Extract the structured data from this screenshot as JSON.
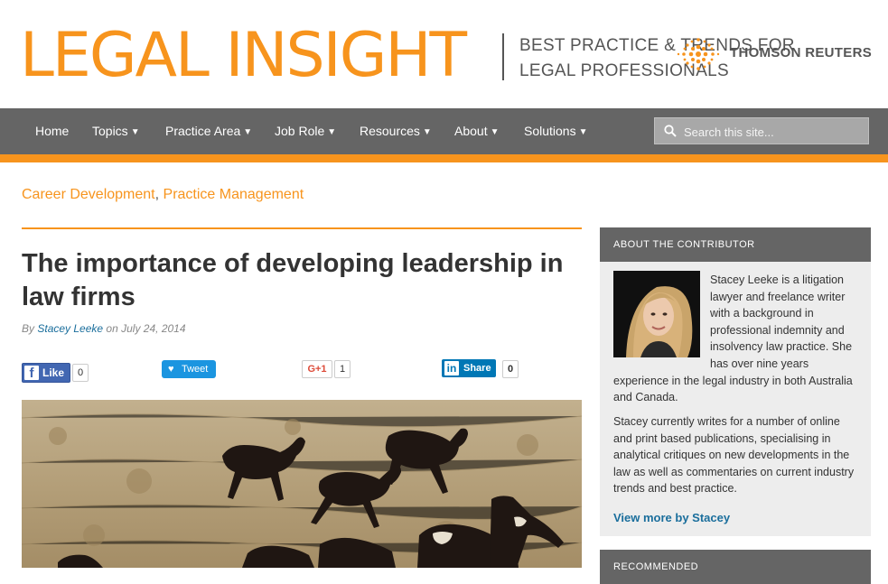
{
  "header": {
    "logo_text": "LEGAL INSIGHT",
    "tagline": "BEST PRACTICE & TRENDS FOR LEGAL PROFESSIONALS",
    "partner_logo": "THOMSON REUTERS"
  },
  "nav": {
    "items": [
      {
        "label": "Home"
      },
      {
        "label": "Topics"
      },
      {
        "label": "Practice Area"
      },
      {
        "label": "Job Role"
      },
      {
        "label": "Resources"
      },
      {
        "label": "About"
      },
      {
        "label": "Solutions"
      }
    ],
    "search_placeholder": "Search this site..."
  },
  "article": {
    "categories": [
      "Career Development",
      "Practice Management"
    ],
    "category_separator": ",",
    "title": "The importance of developing leadership in law firms",
    "by_prefix": "By",
    "author": "Stacey Leeke",
    "date_prefix": "on",
    "date": "July 24, 2014"
  },
  "share": {
    "facebook_label": "Like",
    "facebook_count": "0",
    "twitter_label": "Tweet",
    "gplus_label": "G+1",
    "gplus_count": "1",
    "linkedin_label": "Share",
    "linkedin_count": "0"
  },
  "sidebar": {
    "contributor_heading": "ABOUT THE CONTRIBUTOR",
    "bio_paragraph_1": "Stacey Leeke is a litigation lawyer and freelance writer with a background in professional indemnity and insolvency law practice. She has over nine years experience in the legal industry in both Australia and Canada.",
    "bio_paragraph_2": "Stacey currently writes for a number of online and print based publications, specialising in analytical critiques on new developments in the law as well as commentaries on current industry trends and best practice.",
    "view_more": "View more by Stacey",
    "next_heading": "RECOMMENDED"
  },
  "colors": {
    "brand_orange": "#f7941d",
    "nav_gray": "#656565",
    "link_blue": "#1a6e9c"
  },
  "icons": [
    "search-icon",
    "chevron-down-icon",
    "facebook-icon",
    "twitter-icon",
    "linkedin-icon",
    "thomson-reuters-logo"
  ]
}
